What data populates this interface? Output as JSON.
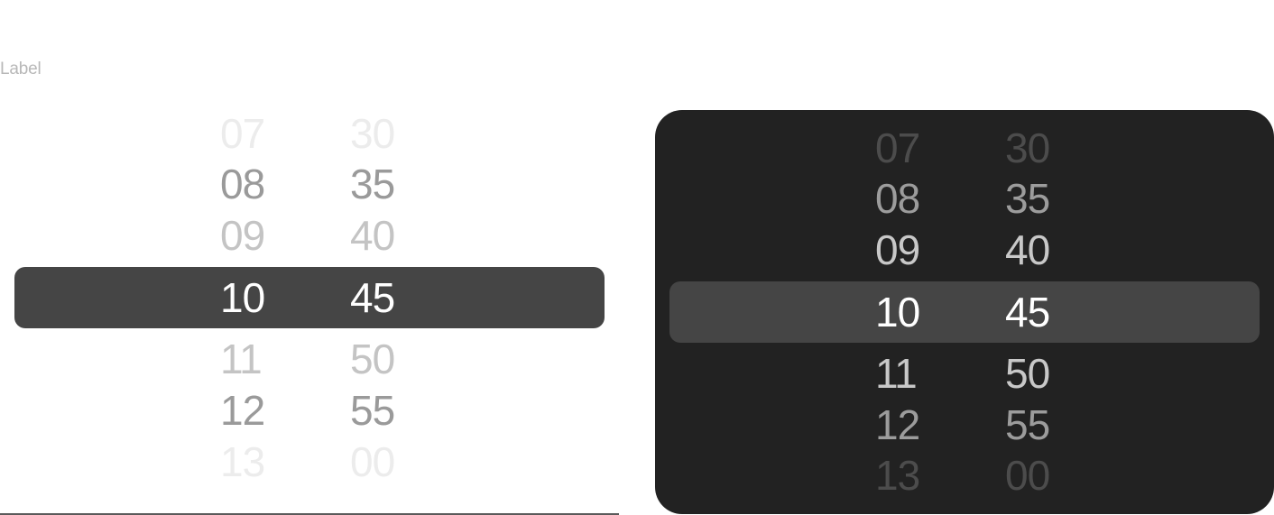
{
  "light_picker": {
    "label": "Label",
    "hours": [
      "07",
      "08",
      "09",
      "10",
      "11",
      "12",
      "13"
    ],
    "minutes": [
      "30",
      "35",
      "40",
      "45",
      "50",
      "55",
      "00"
    ],
    "selected_hour": "10",
    "selected_minute": "45",
    "colors": {
      "background": "#ffffff",
      "highlight": "#454545",
      "label": "#b8b8b8",
      "underline": "#5a5a5a"
    }
  },
  "dark_picker": {
    "hours": [
      "07",
      "08",
      "09",
      "10",
      "11",
      "12",
      "13"
    ],
    "minutes": [
      "30",
      "35",
      "40",
      "45",
      "50",
      "55",
      "00"
    ],
    "selected_hour": "10",
    "selected_minute": "45",
    "colors": {
      "background": "#222222",
      "highlight": "#454545"
    }
  }
}
